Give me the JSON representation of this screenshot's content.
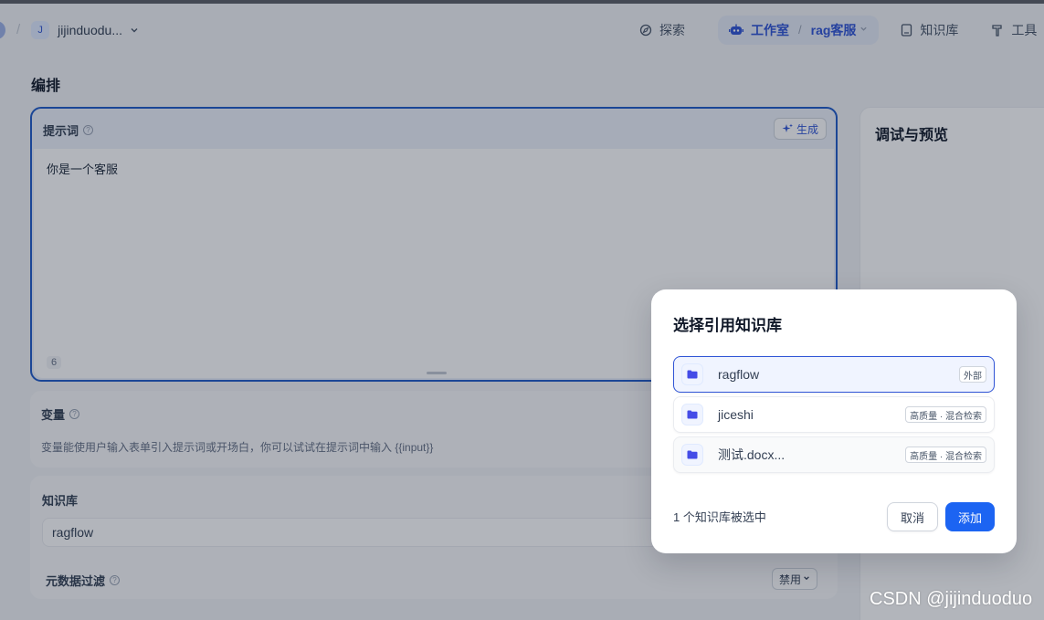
{
  "header": {
    "workspace_initial": "J",
    "workspace_name": "jijinduodu...",
    "separator": "/",
    "nav_explore": "探索",
    "nav_studio": "工作室",
    "studio_separator": "/",
    "app_name": "rag客服",
    "nav_knowledge": "知识库",
    "nav_tools": "工具"
  },
  "main": {
    "page_title": "编排",
    "prompt": {
      "label": "提示词",
      "generate_label": "生成",
      "text": "你是一个客服",
      "char_count": "6"
    },
    "variables": {
      "label": "变量",
      "description": "变量能使用户输入表单引入提示词或开场白，你可以试试在提示词中输入 {{input}}"
    },
    "knowledge": {
      "label": "知识库",
      "selected_item": "ragflow",
      "metadata_filter_label": "元数据过滤",
      "metadata_filter_value": "禁用"
    },
    "preview": {
      "title": "调试与预览"
    }
  },
  "modal": {
    "title": "选择引用知识库",
    "items": [
      {
        "name": "ragflow",
        "tag": "外部",
        "selected": true
      },
      {
        "name": "jiceshi",
        "tag": "高质量 · 混合检索",
        "selected": false
      },
      {
        "name": "测试.docx...",
        "tag": "高质量 · 混合检索",
        "selected": false
      }
    ],
    "selected_count_text": "1 个知识库被选中",
    "cancel_label": "取消",
    "add_label": "添加"
  },
  "watermark": "CSDN @jijinduoduo",
  "colors": {
    "accent": "#1c64f2",
    "studio_text": "#2f54d6",
    "selected_border": "#2f54d6"
  }
}
